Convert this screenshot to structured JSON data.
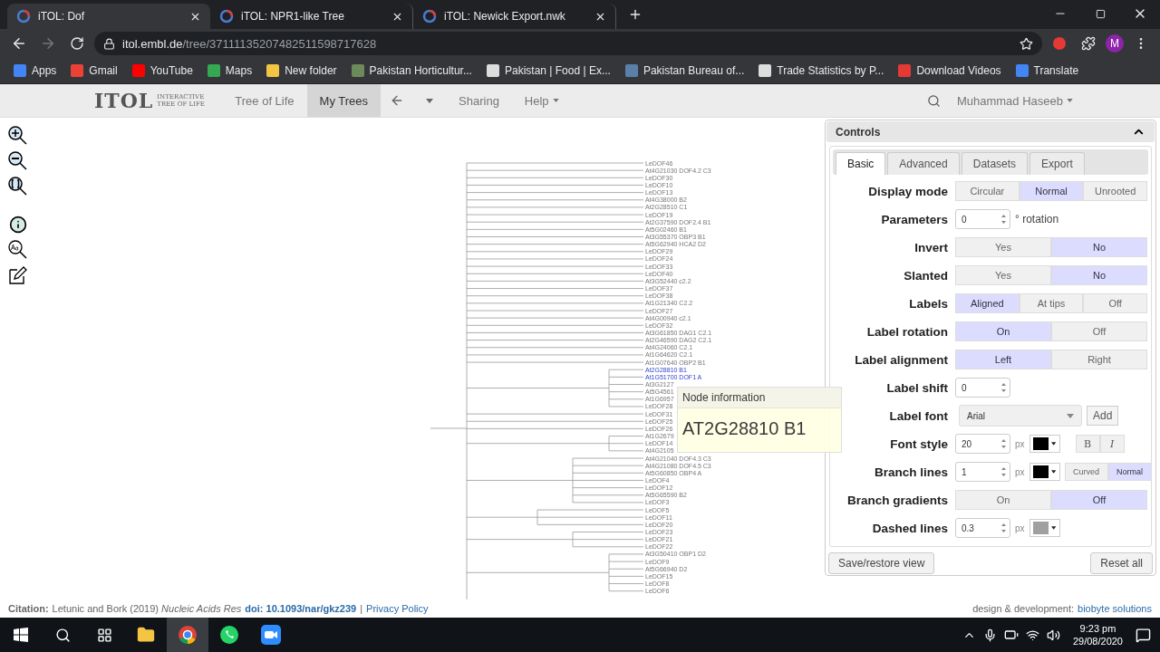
{
  "browser": {
    "tabs": [
      {
        "title": "iTOL: Dof",
        "selected": true
      },
      {
        "title": "iTOL: NPR1-like Tree",
        "selected": false
      },
      {
        "title": "iTOL: Newick Export.nwk",
        "selected": false
      }
    ],
    "url_host": "itol.embl.de",
    "url_path": "/tree/37111135207482511598717628",
    "profile": "M",
    "bookmarks": [
      {
        "label": "Apps",
        "color": "#4285f4"
      },
      {
        "label": "Gmail",
        "color": "#ea4335"
      },
      {
        "label": "YouTube",
        "color": "#ff0000"
      },
      {
        "label": "Maps",
        "color": "#34a853"
      },
      {
        "label": "New folder",
        "color": "#f4c542"
      },
      {
        "label": "Pakistan Horticultur...",
        "color": "#6d8b5a"
      },
      {
        "label": "Pakistan | Food | Ex...",
        "color": "#dddddd"
      },
      {
        "label": "Pakistan Bureau of...",
        "color": "#5a7fa8"
      },
      {
        "label": "Trade Statistics by P...",
        "color": "#dddddd"
      },
      {
        "label": "Download Videos",
        "color": "#e53935"
      },
      {
        "label": "Translate",
        "color": "#4285f4"
      }
    ]
  },
  "site": {
    "logo": "ITOL",
    "logo_sub": "INTERACTIVE TREE OF LIFE",
    "nav": [
      {
        "label": "Tree of Life",
        "selected": false
      },
      {
        "label": "My Trees",
        "selected": true
      }
    ],
    "nav_more": [
      {
        "label": "Sharing",
        "menu": false
      },
      {
        "label": "Help",
        "menu": true
      }
    ],
    "user": "Muhammad Haseeb"
  },
  "tree": {
    "leaves": [
      {
        "label": "LeDOF46",
        "highlighted": false
      },
      {
        "label": "At4G21030 DOF4.2 C3",
        "highlighted": false
      },
      {
        "label": "LeDOF30",
        "highlighted": false
      },
      {
        "label": "LeDOF10",
        "highlighted": false
      },
      {
        "label": "LeDOF13",
        "highlighted": false
      },
      {
        "label": "At4G38000 B2",
        "highlighted": false
      },
      {
        "label": "At2G28510 C1",
        "highlighted": false
      },
      {
        "label": "LeDOF19",
        "highlighted": false
      },
      {
        "label": "At2G37590 DOF2.4 B1",
        "highlighted": false
      },
      {
        "label": "At5G02460 B1",
        "highlighted": false
      },
      {
        "label": "At3G55370 OBP3 B1",
        "highlighted": false
      },
      {
        "label": "At5G62940 HCA2 D2",
        "highlighted": false
      },
      {
        "label": "LeDOF29",
        "highlighted": false
      },
      {
        "label": "LeDOF24",
        "highlighted": false
      },
      {
        "label": "LeDOF33",
        "highlighted": false
      },
      {
        "label": "LeDOF40",
        "highlighted": false
      },
      {
        "label": "At3G52440 c2.2",
        "highlighted": false
      },
      {
        "label": "LeDOF37",
        "highlighted": false
      },
      {
        "label": "LeDOF38",
        "highlighted": false
      },
      {
        "label": "At1G21340 C2.2",
        "highlighted": false
      },
      {
        "label": "LeDOF27",
        "highlighted": false
      },
      {
        "label": "At4G00940 c2.1",
        "highlighted": false
      },
      {
        "label": "LeDOF32",
        "highlighted": false
      },
      {
        "label": "At3G61850 DAG1 C2.1",
        "highlighted": false
      },
      {
        "label": "At2G46590 DAG2 C2.1",
        "highlighted": false
      },
      {
        "label": "At4G24060 C2.1",
        "highlighted": false
      },
      {
        "label": "At1G64620 C2.1",
        "highlighted": false
      },
      {
        "label": "At1G07640 OBP2 B1",
        "highlighted": false
      },
      {
        "label": "At2G28810 B1",
        "highlighted": true
      },
      {
        "label": "At1G51700 DOF1 A",
        "highlighted": true
      },
      {
        "label": "At3G2127",
        "highlighted": false
      },
      {
        "label": "At5G4561",
        "highlighted": false
      },
      {
        "label": "At1G6957",
        "highlighted": false
      },
      {
        "label": "LeDOF28",
        "highlighted": false
      },
      {
        "label": "LeDOF31",
        "highlighted": false
      },
      {
        "label": "LeDOF25",
        "highlighted": false
      },
      {
        "label": "LeDOF26",
        "highlighted": false
      },
      {
        "label": "At1G2679",
        "highlighted": false
      },
      {
        "label": "LeDOF14",
        "highlighted": false
      },
      {
        "label": "At4G2105",
        "highlighted": false
      },
      {
        "label": "At4G21040 DOF4.3 C3",
        "highlighted": false
      },
      {
        "label": "At4G21080 DOF4.5 C3",
        "highlighted": false
      },
      {
        "label": "At5G60850 OBP4 A",
        "highlighted": false
      },
      {
        "label": "LeDOF4",
        "highlighted": false
      },
      {
        "label": "LeDOF12",
        "highlighted": false
      },
      {
        "label": "At5G65590 B2",
        "highlighted": false
      },
      {
        "label": "LeDOF3",
        "highlighted": false
      },
      {
        "label": "LeDOF5",
        "highlighted": false
      },
      {
        "label": "LeDOF11",
        "highlighted": false
      },
      {
        "label": "LeDOF20",
        "highlighted": false
      },
      {
        "label": "LeDOF23",
        "highlighted": false
      },
      {
        "label": "LeDOF21",
        "highlighted": false
      },
      {
        "label": "LeDOF22",
        "highlighted": false
      },
      {
        "label": "At3G50410 OBP1 D2",
        "highlighted": false
      },
      {
        "label": "LeDOF9",
        "highlighted": false
      },
      {
        "label": "At5G66940 D2",
        "highlighted": false
      },
      {
        "label": "LeDOF15",
        "highlighted": false
      },
      {
        "label": "LeDOF8",
        "highlighted": false
      },
      {
        "label": "LeDOF6",
        "highlighted": false
      }
    ]
  },
  "tooltip": {
    "title": "Node information",
    "value": "AT2G28810 B1"
  },
  "controls": {
    "title": "Controls",
    "tabs": [
      {
        "label": "Basic",
        "selected": true
      },
      {
        "label": "Advanced",
        "selected": false
      },
      {
        "label": "Datasets",
        "selected": false
      },
      {
        "label": "Export",
        "selected": false
      }
    ],
    "rows": [
      {
        "label": "Display mode",
        "parts": [
          {
            "kind": "segmented",
            "options": [
              {
                "label": "Circular",
                "selected": false
              },
              {
                "label": "Normal",
                "selected": true
              },
              {
                "label": "Unrooted",
                "selected": false
              }
            ]
          }
        ]
      },
      {
        "label": "Parameters",
        "parts": [
          {
            "kind": "spinner",
            "value": "0"
          },
          {
            "kind": "text",
            "text": "° rotation"
          }
        ]
      },
      {
        "label": "Invert",
        "parts": [
          {
            "kind": "segmented",
            "options": [
              {
                "label": "Yes",
                "selected": false
              },
              {
                "label": "No",
                "selected": true
              }
            ]
          }
        ]
      },
      {
        "label": "Slanted",
        "parts": [
          {
            "kind": "segmented",
            "options": [
              {
                "label": "Yes",
                "selected": false
              },
              {
                "label": "No",
                "selected": true
              }
            ]
          }
        ]
      },
      {
        "label": "Labels",
        "parts": [
          {
            "kind": "segmented",
            "options": [
              {
                "label": "Aligned",
                "selected": true
              },
              {
                "label": "At tips",
                "selected": false
              },
              {
                "label": "Off",
                "selected": false
              }
            ]
          }
        ]
      },
      {
        "label": "Label rotation",
        "parts": [
          {
            "kind": "segmented",
            "options": [
              {
                "label": "On",
                "selected": true
              },
              {
                "label": "Off",
                "selected": false
              }
            ]
          }
        ]
      },
      {
        "label": "Label alignment",
        "parts": [
          {
            "kind": "segmented",
            "options": [
              {
                "label": "Left",
                "selected": true
              },
              {
                "label": "Right",
                "selected": false
              }
            ]
          }
        ]
      },
      {
        "label": "Label shift",
        "parts": [
          {
            "kind": "spinner",
            "value": "0"
          }
        ]
      },
      {
        "label": "Label font",
        "parts": [
          {
            "kind": "select",
            "value": "Arial"
          },
          {
            "kind": "button",
            "label": "Add"
          }
        ]
      },
      {
        "label": "Font style",
        "parts": [
          {
            "kind": "spinner",
            "value": "20"
          },
          {
            "kind": "text",
            "text": "px"
          },
          {
            "kind": "color",
            "color": "#000000"
          },
          {
            "kind": "styles",
            "options": [
              {
                "label": "B",
                "selected": false
              },
              {
                "label": "I",
                "selected": false
              }
            ]
          }
        ]
      },
      {
        "label": "Branch lines",
        "parts": [
          {
            "kind": "spinner",
            "value": "1"
          },
          {
            "kind": "text",
            "text": "px"
          },
          {
            "kind": "color",
            "color": "#000000"
          },
          {
            "kind": "small_segmented",
            "options": [
              {
                "label": "Curved",
                "selected": false
              },
              {
                "label": "Normal",
                "selected": true
              }
            ]
          }
        ]
      },
      {
        "label": "Branch gradients",
        "parts": [
          {
            "kind": "segmented",
            "options": [
              {
                "label": "On",
                "selected": false
              },
              {
                "label": "Off",
                "selected": true
              }
            ]
          }
        ]
      },
      {
        "label": "Dashed lines",
        "parts": [
          {
            "kind": "spinner",
            "value": "0.3"
          },
          {
            "kind": "text",
            "text": "px"
          },
          {
            "kind": "color",
            "color": "#a0a0a0"
          }
        ]
      }
    ],
    "buttons": [
      "Save/restore view",
      "Reset all"
    ]
  },
  "footer": {
    "citation_label": "Citation:",
    "citation_text": "Letunic and Bork (2019) *Nucleic Acids Res*",
    "doi": "doi: 10.1093/nar/gkz239",
    "separator": "|",
    "privacy": "Privacy Policy",
    "credit_text": "design & development:",
    "credit_link": "biobyte solutions"
  },
  "taskbar": {
    "time": "9:23 pm",
    "date": "29/08/2020"
  }
}
